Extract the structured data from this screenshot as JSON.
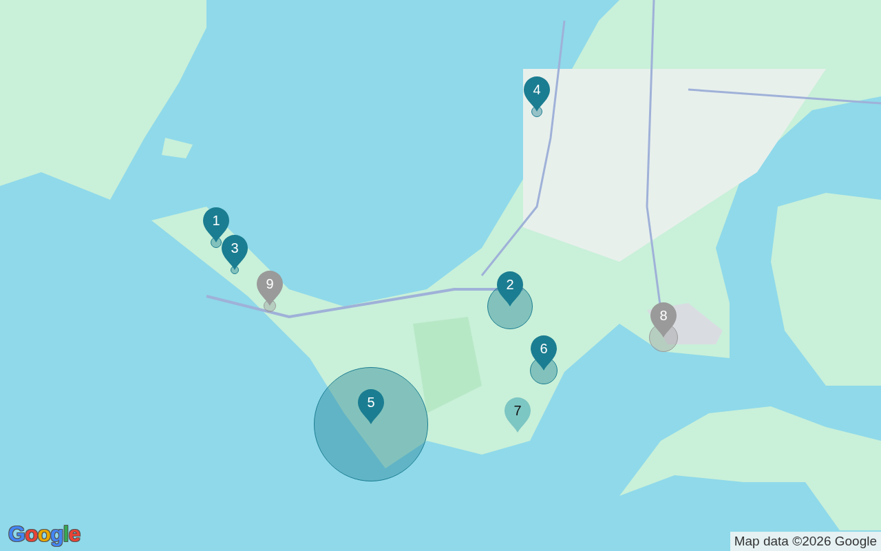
{
  "markers": [
    {
      "label": "1",
      "color": "#1b7d91"
    },
    {
      "label": "2",
      "color": "#1b7d91"
    },
    {
      "label": "3",
      "color": "#1b7d91"
    },
    {
      "label": "4",
      "color": "#1b7d91"
    },
    {
      "label": "5",
      "color": "#1b7d91"
    },
    {
      "label": "6",
      "color": "#1b7d91"
    },
    {
      "label": "7",
      "color": "#7cc6c3"
    },
    {
      "label": "8",
      "color": "#9a9a9a"
    },
    {
      "label": "9",
      "color": "#9a9a9a"
    }
  ],
  "logo": "Google",
  "attribution": "Map data ©2026 Google"
}
